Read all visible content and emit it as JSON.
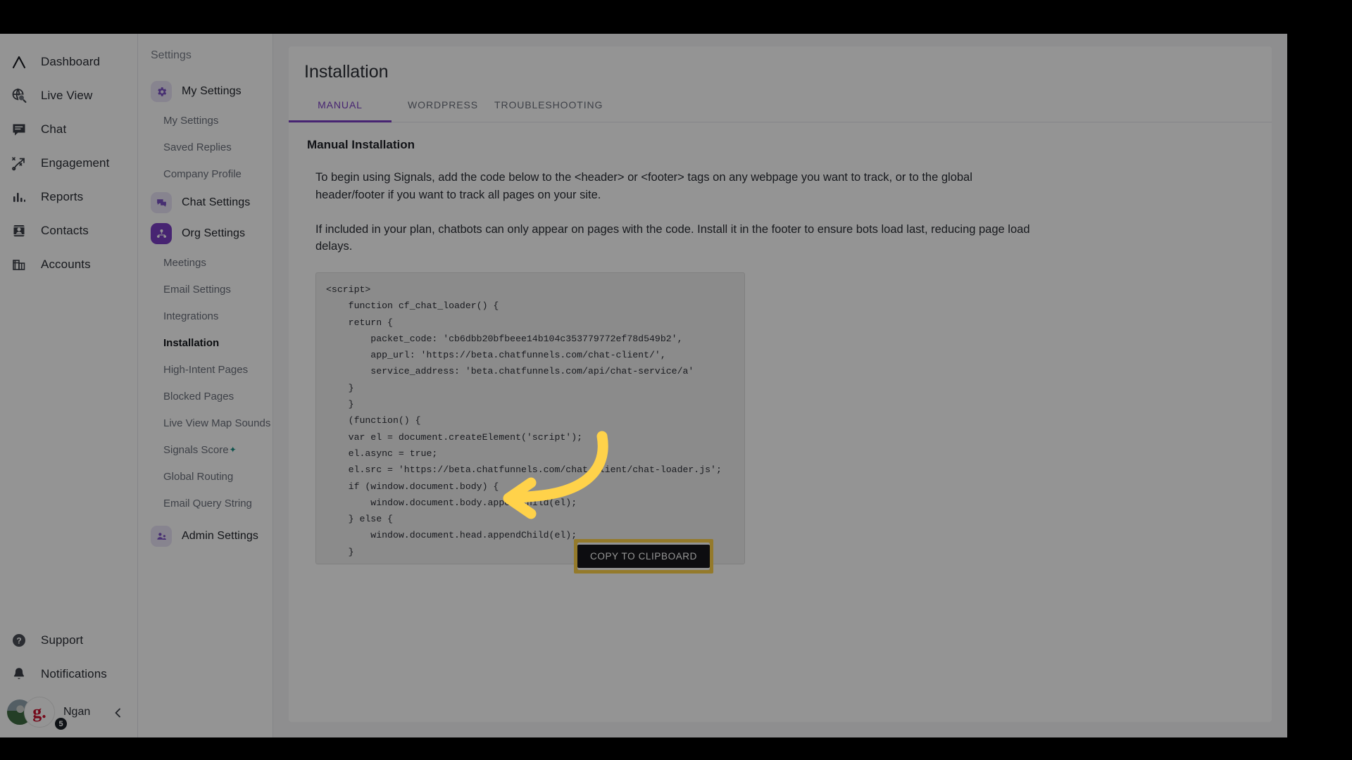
{
  "left_rail": {
    "items": [
      {
        "label": "Dashboard",
        "icon": "logo-chevron-icon"
      },
      {
        "label": "Live View",
        "icon": "globe-search-icon"
      },
      {
        "label": "Chat",
        "icon": "chat-bubble-icon"
      },
      {
        "label": "Engagement",
        "icon": "engagement-path-icon"
      },
      {
        "label": "Reports",
        "icon": "bar-chart-icon"
      },
      {
        "label": "Contacts",
        "icon": "contact-card-icon"
      },
      {
        "label": "Accounts",
        "icon": "accounts-building-icon"
      }
    ],
    "bottom_items": [
      {
        "label": "Support",
        "icon": "help-circle-icon"
      },
      {
        "label": "Notifications",
        "icon": "bell-icon"
      }
    ],
    "user": {
      "name": "Ngan",
      "badge_letter": "g.",
      "notification_count": "5"
    },
    "collapse_icon": "chevron-left-icon"
  },
  "settings_nav": {
    "heading": "Settings",
    "groups": [
      {
        "label": "My Settings",
        "icon": "gear-icon",
        "state": "soft",
        "children": [
          {
            "label": "My Settings",
            "active": false
          },
          {
            "label": "Saved Replies",
            "active": false
          },
          {
            "label": "Company Profile",
            "active": false
          }
        ]
      },
      {
        "label": "Chat Settings",
        "icon": "chat-settings-icon",
        "state": "soft",
        "children": []
      },
      {
        "label": "Org Settings",
        "icon": "org-people-icon",
        "state": "solid",
        "children": [
          {
            "label": "Meetings",
            "active": false
          },
          {
            "label": "Email Settings",
            "active": false
          },
          {
            "label": "Integrations",
            "active": false
          },
          {
            "label": "Installation",
            "active": true
          },
          {
            "label": "High-Intent Pages",
            "active": false
          },
          {
            "label": "Blocked Pages",
            "active": false
          },
          {
            "label": "Live View Map Sounds",
            "active": false
          },
          {
            "label": "Signals Score",
            "active": false,
            "badge": "✦"
          },
          {
            "label": "Global Routing",
            "active": false
          },
          {
            "label": "Email Query String",
            "active": false
          }
        ]
      },
      {
        "label": "Admin Settings",
        "icon": "admin-icon",
        "state": "soft",
        "children": []
      }
    ]
  },
  "main": {
    "title": "Installation",
    "tabs": [
      {
        "label": "MANUAL",
        "active": true
      },
      {
        "label": "WORDPRESS",
        "active": false
      },
      {
        "label": "TROUBLESHOOTING",
        "active": false
      }
    ],
    "section_title": "Manual Installation",
    "paragraph_1": "To begin using Signals, add the code below to the <header> or <footer> tags on any webpage you want to track, or to the global header/footer if you want to track all pages on your site.",
    "paragraph_2": "If included in your plan, chatbots can only appear on pages with the code. Install it in the footer to ensure bots load last, reducing page load delays.",
    "code_snippet": "<script>\n    function cf_chat_loader() {\n    return {\n        packet_code: 'cb6dbb20bfbeee14b104c353779772ef78d549b2',\n        app_url: 'https://beta.chatfunnels.com/chat-client/',\n        service_address: 'beta.chatfunnels.com/api/chat-service/a'\n    }\n    }\n    (function() {\n    var el = document.createElement('script');\n    el.async = true;\n    el.src = 'https://beta.chatfunnels.com/chat-client/chat-loader.js';\n    if (window.document.body) {\n        window.document.body.appendChild(el);\n    } else {\n        window.document.head.appendChild(el);\n    }\n    }());\n    </script>",
    "copy_button_label": "COPY TO CLIPBOARD"
  },
  "annotation": {
    "arrow_color": "#ffd24a",
    "highlight_color": "#ffd24a"
  }
}
